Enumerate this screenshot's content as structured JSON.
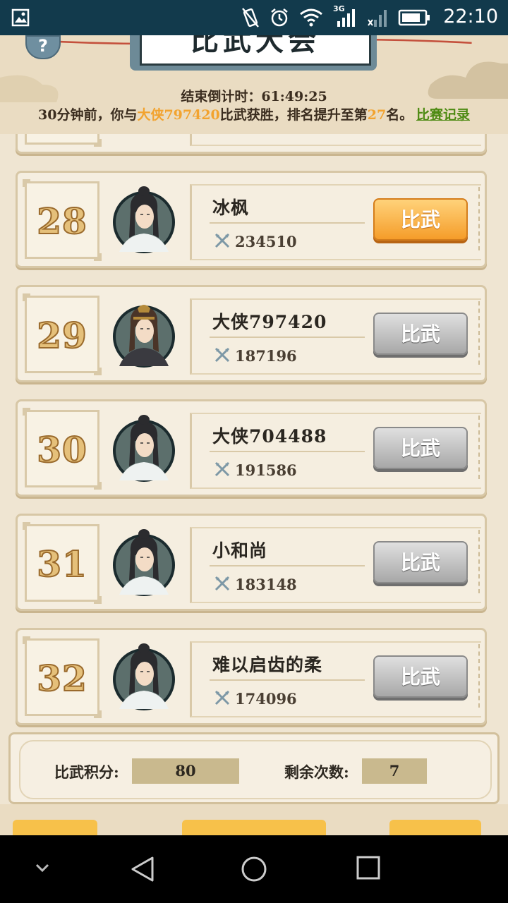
{
  "status_bar": {
    "time": "22:10",
    "network_label": "3G",
    "icons": [
      "gallery-icon",
      "vibrate-icon",
      "alarm-icon",
      "wifi-icon",
      "signal-icon",
      "signal-x-icon",
      "battery-icon"
    ]
  },
  "header": {
    "title": "比武大会",
    "help_symbol": "?",
    "countdown_label": "结束倒计时：",
    "countdown_value": "61:49:25",
    "notice_prefix": "30分钟前，你与",
    "notice_opponent": "大侠797420",
    "notice_mid": "比武获胜，排名提升至第",
    "notice_rank": "27",
    "notice_suffix": "名。",
    "record_link": "比赛记录"
  },
  "colors": {
    "status_bar_bg": "#123a4c",
    "highlight": "#f2a32f",
    "link": "#4d8a12",
    "active_button": "#f59d2a",
    "inactive_button": "#a8a8a8"
  },
  "opponents": [
    {
      "rank": "28",
      "name": "冰枫",
      "power": "234510",
      "button": "比武",
      "active": true
    },
    {
      "rank": "29",
      "name": "大侠797420",
      "power": "187196",
      "button": "比武",
      "active": false
    },
    {
      "rank": "30",
      "name": "大侠704488",
      "power": "191586",
      "button": "比武",
      "active": false
    },
    {
      "rank": "31",
      "name": "小和尚",
      "power": "183148",
      "button": "比武",
      "active": false
    },
    {
      "rank": "32",
      "name": "难以启齿的柔",
      "power": "174096",
      "button": "比武",
      "active": false
    }
  ],
  "stats": {
    "score_label": "比武积分:",
    "score_value": "80",
    "remaining_label": "剩余次数:",
    "remaining_value": "7"
  }
}
